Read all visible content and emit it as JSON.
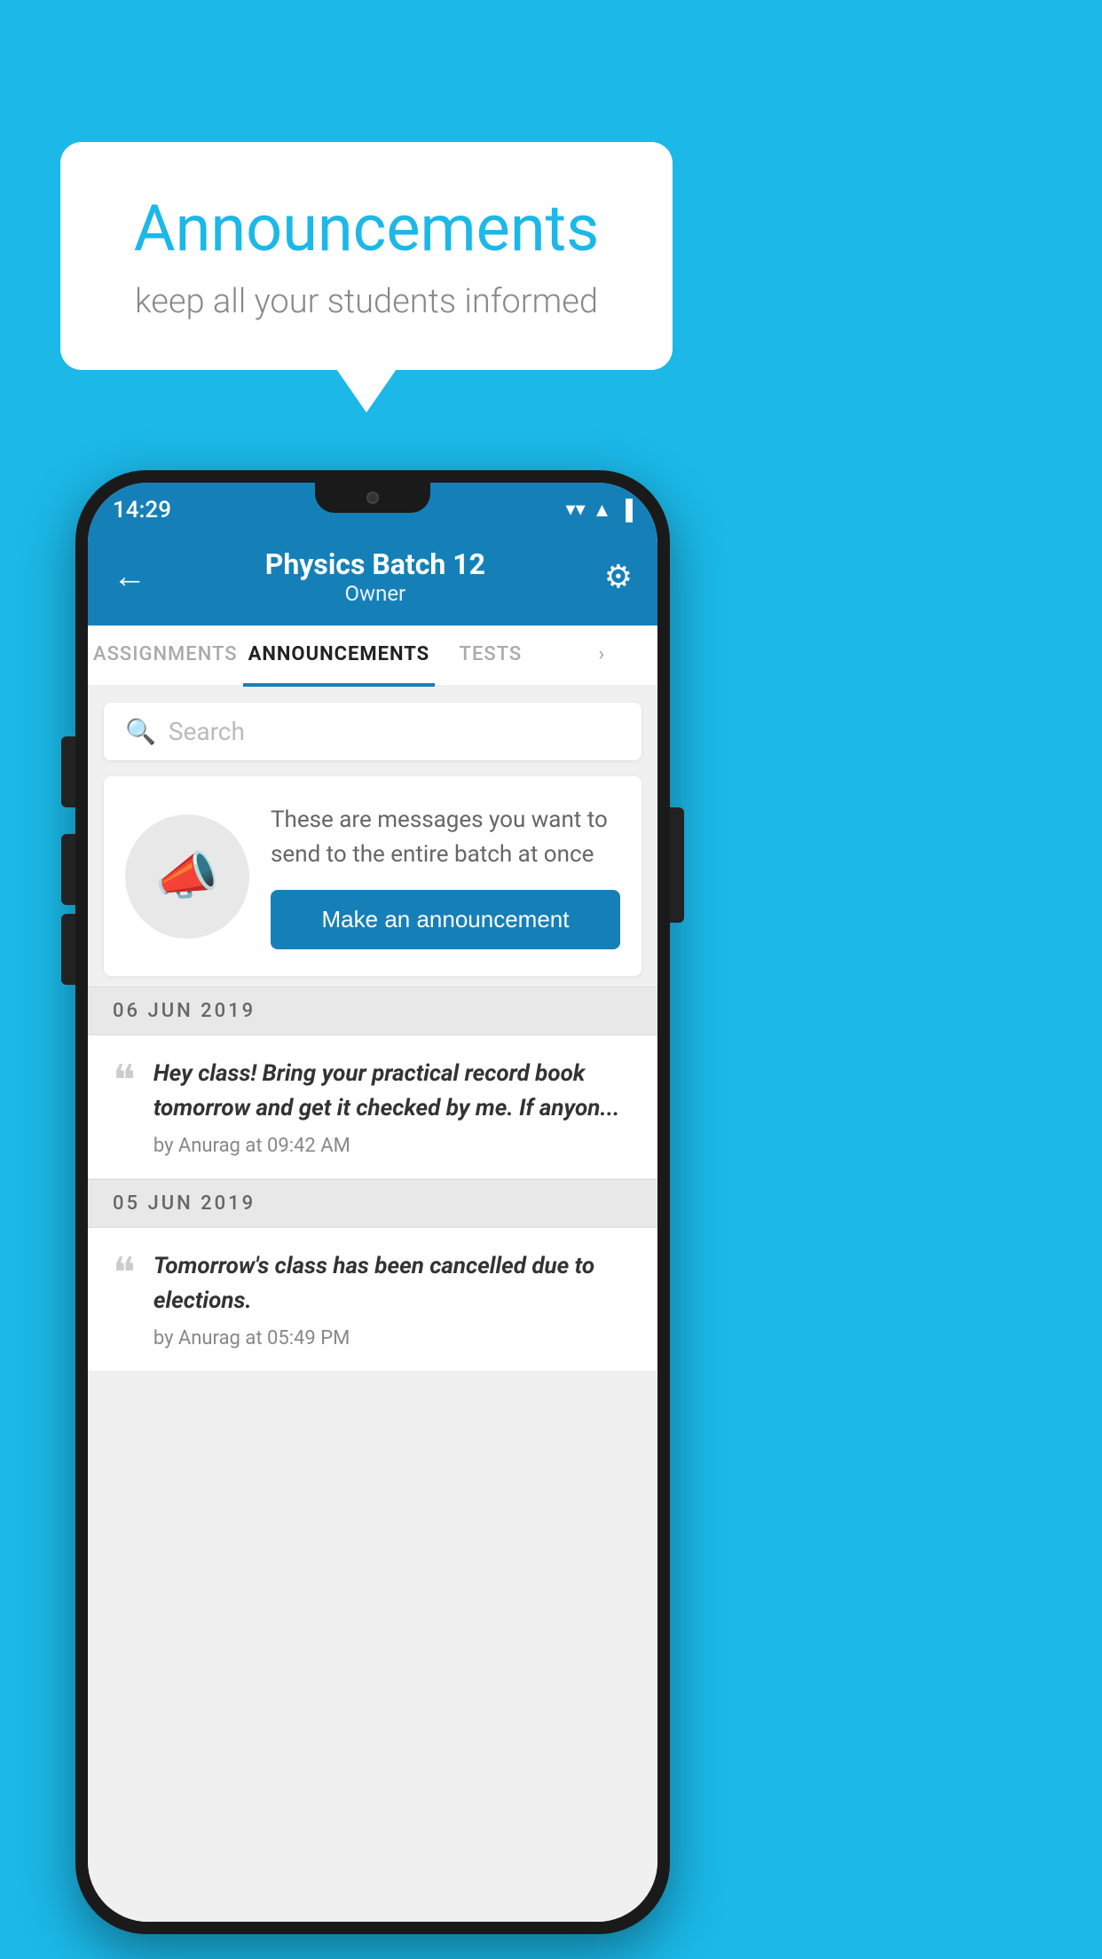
{
  "background_color": "#1BB8E8",
  "speech_bubble": {
    "title": "Announcements",
    "subtitle": "keep all your students informed"
  },
  "phone": {
    "status_bar": {
      "time": "14:29",
      "wifi": "▼",
      "signal": "▲",
      "battery": "▌"
    },
    "header": {
      "back_label": "←",
      "title": "Physics Batch 12",
      "subtitle": "Owner",
      "gear_label": "⚙"
    },
    "tabs": [
      {
        "label": "ASSIGNMENTS",
        "active": false
      },
      {
        "label": "ANNOUNCEMENTS",
        "active": true
      },
      {
        "label": "TESTS",
        "active": false
      },
      {
        "label": "›",
        "active": false
      }
    ],
    "search": {
      "placeholder": "Search"
    },
    "promo": {
      "description": "These are messages you want to send to the entire batch at once",
      "button_label": "Make an announcement"
    },
    "announcements": [
      {
        "date": "06  JUN  2019",
        "message": "Hey class! Bring your practical record book tomorrow and get it checked by me. If anyon...",
        "meta": "by Anurag at 09:42 AM"
      },
      {
        "date": "05  JUN  2019",
        "message": "Tomorrow's class has been cancelled due to elections.",
        "meta": "by Anurag at 05:49 PM"
      }
    ]
  }
}
